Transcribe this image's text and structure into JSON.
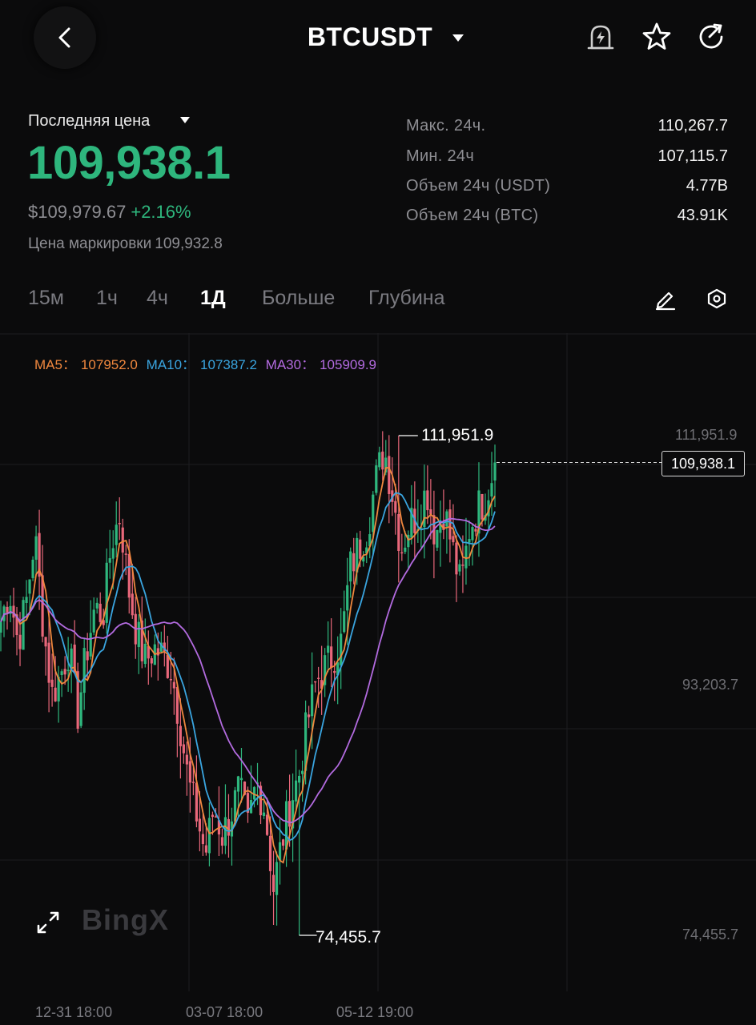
{
  "header": {
    "symbol": "BTCUSDT",
    "icons": [
      "back-arrow-icon",
      "chevron-down-icon",
      "price-alert-bell-icon",
      "star-icon",
      "share-icon"
    ]
  },
  "ticker": {
    "last_price_label": "Последняя цена",
    "last_price": "109,938.1",
    "usd_price": "$109,979.67",
    "change": "+2.16%",
    "mark_label": "Цена маркировки",
    "mark_price": "109,932.8",
    "stats": [
      {
        "label": "Макс. 24ч.",
        "value": "110,267.7"
      },
      {
        "label": "Мин. 24ч",
        "value": "107,115.7"
      },
      {
        "label": "Объем 24ч (USDT)",
        "value": "4.77B"
      },
      {
        "label": "Объем 24ч (BTC)",
        "value": "43.91K"
      }
    ]
  },
  "timeframes": {
    "tabs": [
      "15м",
      "1ч",
      "4ч",
      "1Д",
      "Больше",
      "Глубина"
    ],
    "active": "1Д",
    "tool_icons": [
      "pencil-draw-icon",
      "settings-hexagon-icon"
    ]
  },
  "chart": {
    "ma5_label": "MA5：",
    "ma5_value": "107952.0",
    "ma10_label": "MA10：",
    "ma10_value": "107387.2",
    "ma30_label": "MA30：",
    "ma30_value": "105909.9",
    "axis_top": "111,951.9",
    "axis_mid": "93,203.7",
    "axis_bottom": "74,455.7",
    "current_price_tag": "109,938.1",
    "peak_high_label": "111,951.9",
    "peak_low_label": "74,455.7",
    "dates": [
      "12-31 18:00",
      "03-07 18:00",
      "05-12 19:00"
    ],
    "watermark": "BingX"
  },
  "colors": {
    "up": "#2eb67d",
    "down": "#e8677a",
    "ma5": "#f0883e",
    "ma10": "#3aa5e0",
    "ma30": "#b36be0",
    "background": "#0b0b0c"
  },
  "chart_data": {
    "type": "candlestick",
    "y_axis_ticks": [
      111951.9,
      93203.7,
      74455.7
    ],
    "x_tick_labels": [
      "12-31 18:00",
      "03-07 18:00",
      "05-12 19:00"
    ],
    "period": "1Д",
    "series_ma": [
      {
        "name": "MA5",
        "last": 107952.0
      },
      {
        "name": "MA10",
        "last": 107387.2
      },
      {
        "name": "MA30",
        "last": 105909.9
      }
    ],
    "visible_high": 111951.9,
    "visible_low": 74455.7,
    "last_close": 109938.1,
    "close_path": [
      98000,
      100500,
      96500,
      99500,
      104500,
      97500,
      92500,
      94000,
      96000,
      91000,
      95500,
      99000,
      98500,
      104000,
      106000,
      100500,
      97000,
      95000,
      96000,
      95500,
      94500,
      90500,
      86000,
      83500,
      80500,
      84000,
      82000,
      83500,
      85500,
      82500,
      86000,
      84000,
      78000,
      81500,
      84500,
      86500,
      90500,
      93500,
      94500,
      95500,
      96500,
      102000,
      103500,
      105000,
      108500,
      111000,
      107500,
      103500,
      105500,
      106000,
      108000,
      104500,
      106500,
      103500,
      100500,
      105000,
      106500,
      107500,
      109938.1
    ]
  }
}
